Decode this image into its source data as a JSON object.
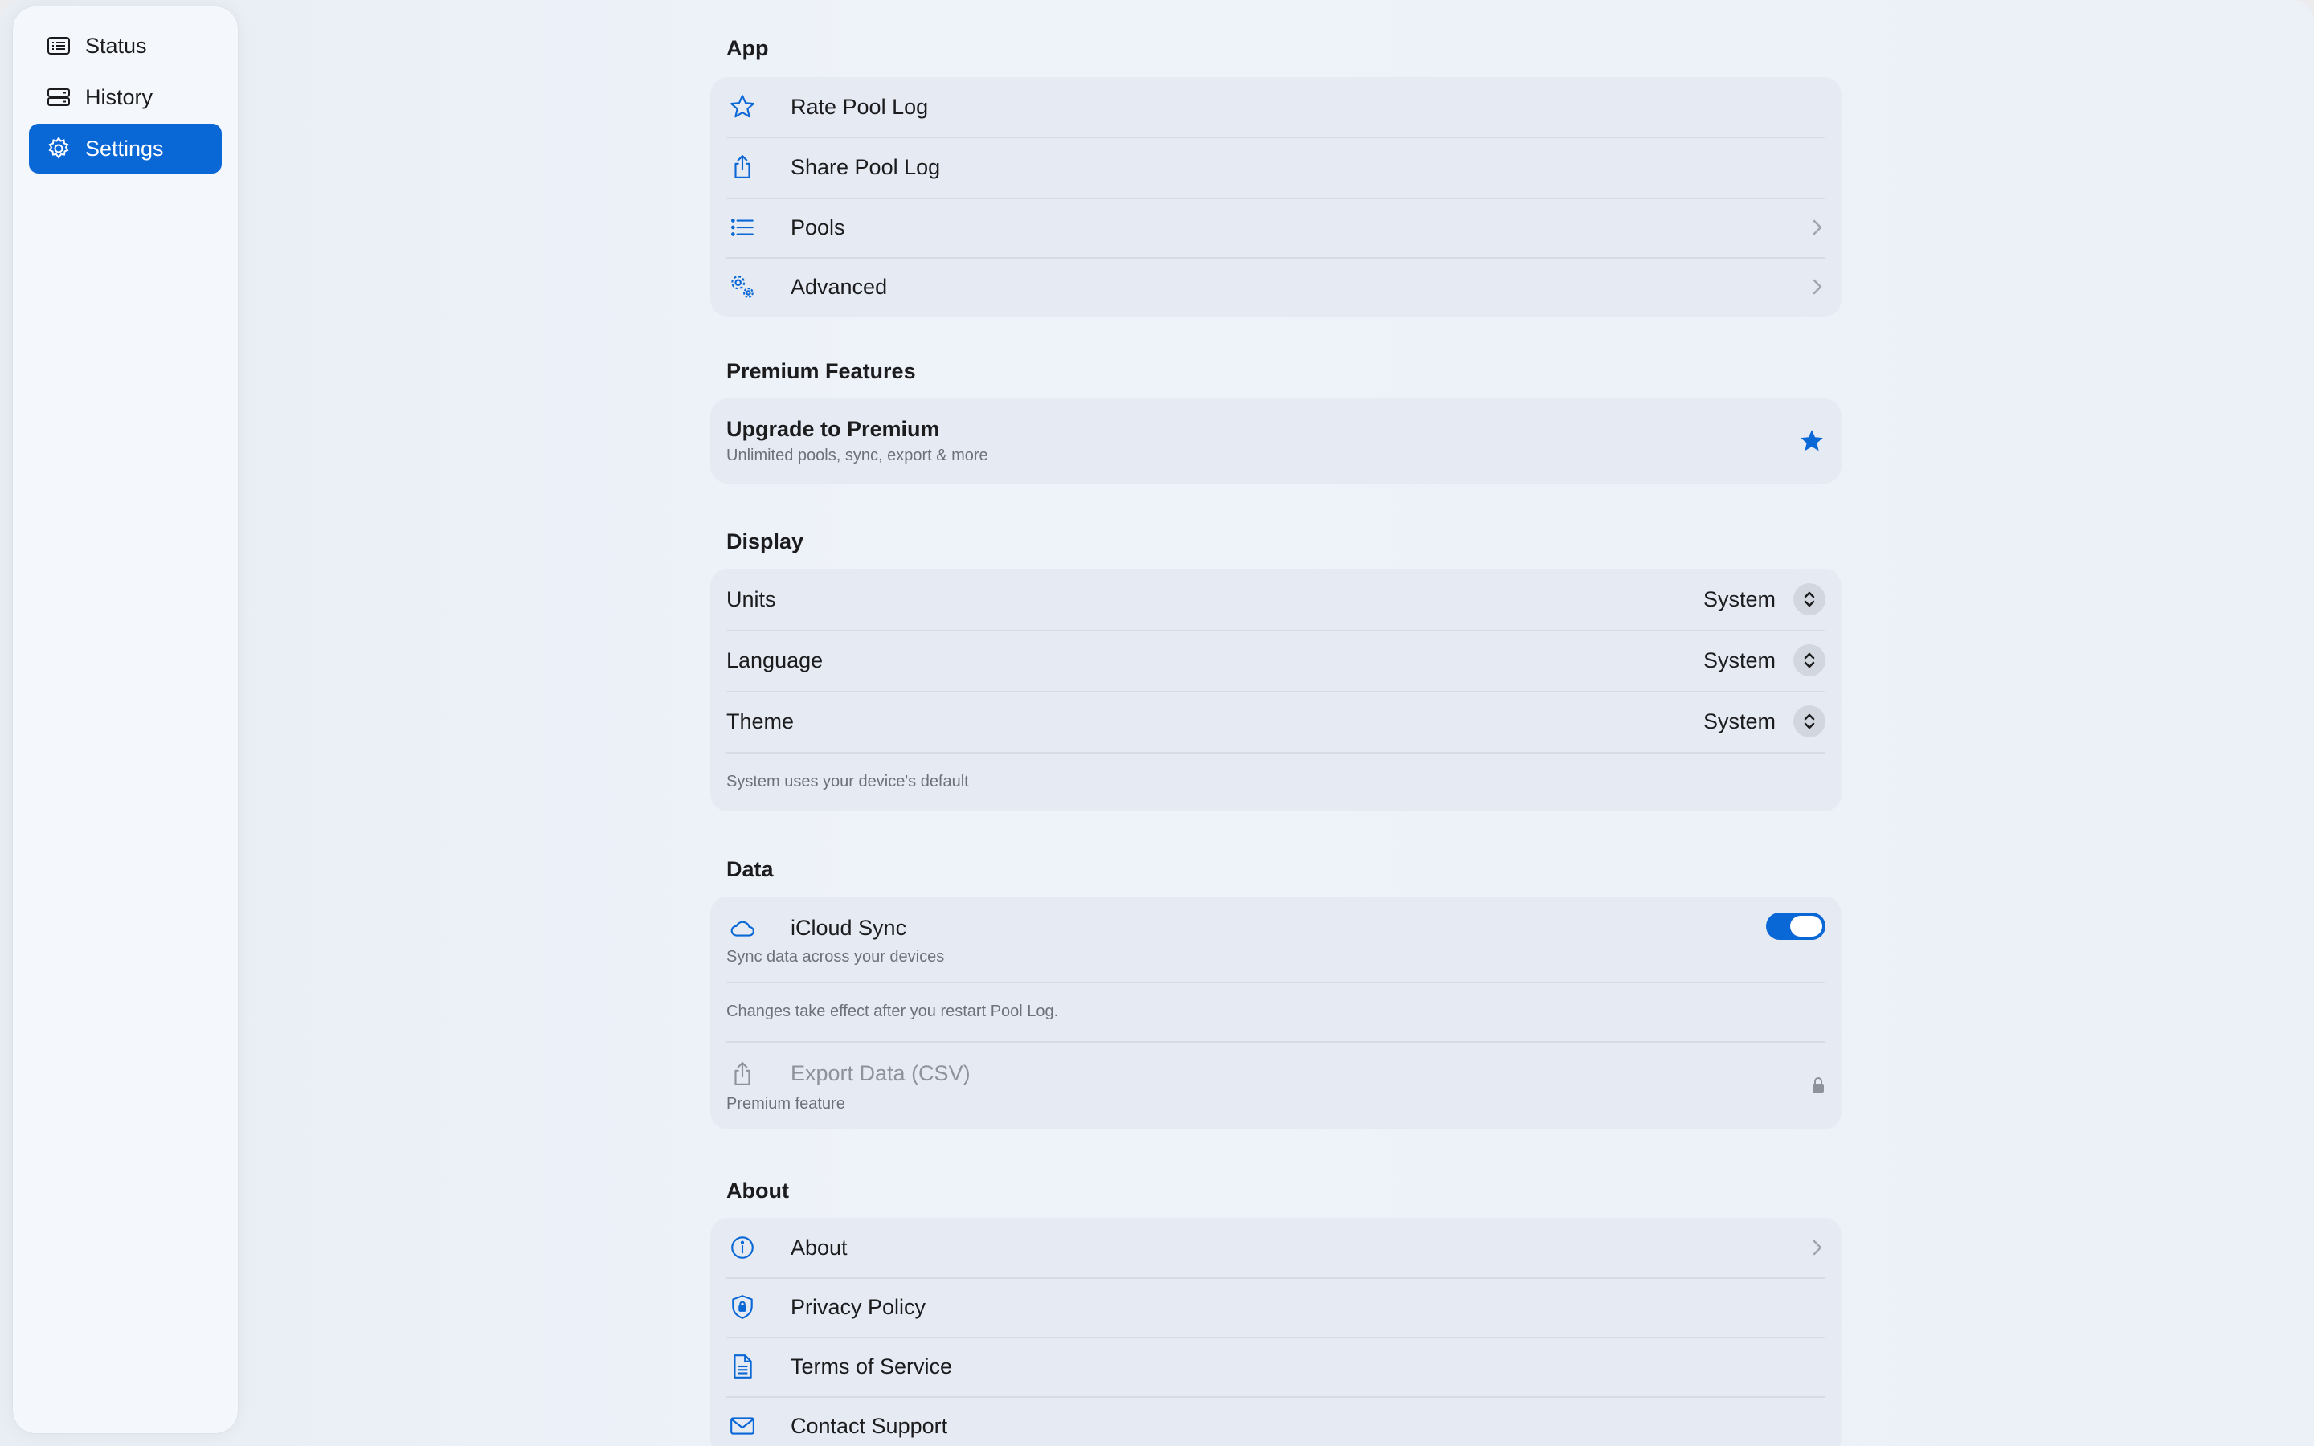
{
  "sidebar": {
    "items": [
      {
        "label": "Status",
        "icon": "list-rectangle-icon"
      },
      {
        "label": "History",
        "icon": "clock-list-icon"
      },
      {
        "label": "Settings",
        "icon": "gear-icon"
      }
    ],
    "active_index": 2
  },
  "sections": {
    "app": {
      "title": "App",
      "rate": "Rate Pool Log",
      "share": "Share Pool Log",
      "pools": "Pools",
      "advanced": "Advanced"
    },
    "premium": {
      "title": "Premium Features",
      "upgrade": "Upgrade to Premium",
      "upgrade_sub": "Unlimited pools, sync, export & more"
    },
    "display": {
      "title": "Display",
      "units_label": "Units",
      "units_value": "System",
      "language_label": "Language",
      "language_value": "System",
      "theme_label": "Theme",
      "theme_value": "System",
      "note": "System uses your device's default"
    },
    "data": {
      "title": "Data",
      "icloud": "iCloud Sync",
      "icloud_sub": "Sync data across your devices",
      "icloud_on": true,
      "restart_note": "Changes take effect after you restart Pool Log.",
      "export": "Export Data (CSV)",
      "export_sub": "Premium feature"
    },
    "about": {
      "title": "About",
      "about": "About",
      "privacy": "Privacy Policy",
      "terms": "Terms of Service",
      "contact": "Contact Support"
    }
  },
  "colors": {
    "accent": "#0a67d6",
    "group_bg": "#e6ebf3",
    "secondary_text": "#6d717a"
  }
}
